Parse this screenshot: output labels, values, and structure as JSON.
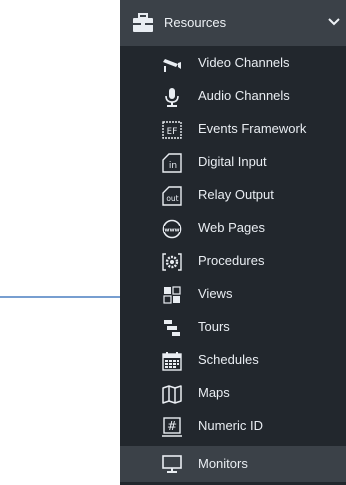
{
  "header": {
    "label": "Resources",
    "icon": "briefcase-icon"
  },
  "items": [
    {
      "label": "Video Channels",
      "icon": "camera-icon"
    },
    {
      "label": "Audio Channels",
      "icon": "microphone-icon"
    },
    {
      "label": "Events Framework",
      "icon": "events-framework-icon"
    },
    {
      "label": "Digital Input",
      "icon": "digital-input-icon"
    },
    {
      "label": "Relay Output",
      "icon": "relay-output-icon"
    },
    {
      "label": "Web Pages",
      "icon": "globe-icon"
    },
    {
      "label": "Procedures",
      "icon": "procedures-gear-icon"
    },
    {
      "label": "Views",
      "icon": "views-grid-icon"
    },
    {
      "label": "Tours",
      "icon": "tours-icon"
    },
    {
      "label": "Schedules",
      "icon": "calendar-icon"
    },
    {
      "label": "Maps",
      "icon": "map-icon"
    },
    {
      "label": "Numeric ID",
      "icon": "hash-icon"
    },
    {
      "label": "Monitors",
      "icon": "monitor-icon"
    }
  ],
  "icon_text": {
    "events": "EF",
    "digital": "in",
    "relay": "out",
    "web": "www",
    "hash": "#"
  },
  "colors": {
    "sidebar_bg": "#22272d",
    "header_bg": "#3b4148",
    "active_bg": "#3b4148",
    "text": "#e9edf2",
    "arrow": "#4a7fc1"
  }
}
